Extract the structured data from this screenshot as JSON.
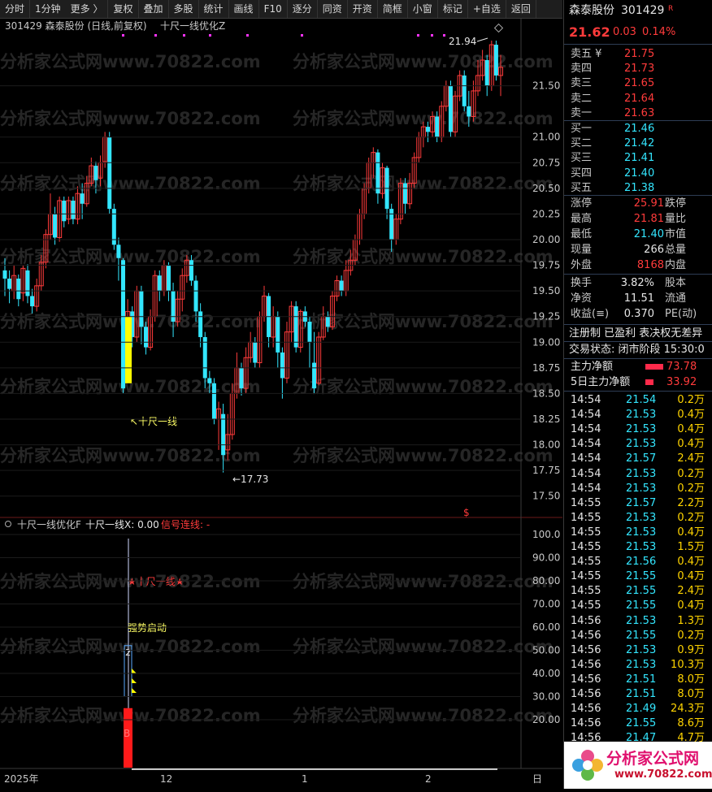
{
  "toolbar": [
    "分时",
    "1分钟",
    "更多 〉",
    "复权",
    "叠加",
    "多股",
    "统计",
    "画线",
    "F10",
    "逐分",
    "同资",
    "开资",
    "简框",
    "小窗",
    "标记",
    "+自选",
    "返回"
  ],
  "main_header": {
    "code_name": "301429 森泰股份 (日线,前复权)",
    "indicator": "十尺一线优化Z"
  },
  "sub_header": {
    "name": "十尺一线优化F",
    "value_label": "十尺一线X: 0.00",
    "signal_label": "信号连线: -"
  },
  "watermark_text": "分析家公式网www.70822.com",
  "chart_data": [
    {
      "type": "candlestick",
      "title": "301429 森泰股份 (日线,前复权)",
      "yticks": [
        "21.50",
        "21.00",
        "20.75",
        "20.50",
        "20.25",
        "20.00",
        "19.75",
        "19.50",
        "19.25",
        "19.00",
        "18.75",
        "18.50",
        "18.25",
        "18.00",
        "17.75",
        "17.50"
      ],
      "ylim": [
        17.5,
        22.05
      ],
      "candles": [
        [
          19.7,
          19.62,
          19.82,
          19.45
        ],
        [
          19.62,
          19.52,
          19.7,
          19.38
        ],
        [
          19.5,
          19.65,
          19.75,
          19.42
        ],
        [
          19.62,
          19.42,
          19.66,
          19.35
        ],
        [
          19.48,
          19.72,
          19.75,
          19.4
        ],
        [
          19.7,
          19.45,
          19.76,
          19.38
        ],
        [
          19.45,
          19.35,
          19.52,
          19.28
        ],
        [
          19.35,
          19.55,
          19.62,
          19.3
        ],
        [
          19.55,
          19.78,
          19.85,
          19.5
        ],
        [
          19.78,
          20.05,
          20.1,
          19.72
        ],
        [
          20.05,
          20.25,
          20.45,
          20.0
        ],
        [
          20.25,
          20.02,
          20.32,
          19.95
        ],
        [
          20.02,
          20.38,
          20.42,
          19.98
        ],
        [
          20.38,
          20.18,
          20.42,
          20.12
        ],
        [
          20.2,
          20.38,
          20.42,
          20.15
        ],
        [
          20.38,
          20.2,
          20.42,
          20.15
        ],
        [
          20.2,
          20.45,
          20.52,
          20.15
        ],
        [
          20.45,
          20.35,
          20.55,
          20.2
        ],
        [
          20.35,
          20.55,
          20.62,
          20.32
        ],
        [
          20.55,
          20.72,
          20.8,
          20.52
        ],
        [
          20.72,
          20.58,
          20.76,
          20.45
        ],
        [
          20.6,
          20.75,
          20.82,
          20.52
        ],
        [
          20.76,
          21.0,
          21.05,
          20.7
        ],
        [
          21.0,
          20.3,
          21.05,
          20.25
        ],
        [
          20.3,
          19.95,
          20.35,
          19.9
        ],
        [
          19.95,
          19.82,
          20.02,
          19.6
        ],
        [
          19.8,
          18.55,
          19.82,
          18.5
        ],
        [
          18.9,
          19.3,
          19.42,
          18.88
        ],
        [
          19.3,
          19.05,
          19.35,
          18.95
        ],
        [
          19.05,
          19.5,
          19.55,
          19.0
        ],
        [
          19.5,
          19.15,
          19.55,
          18.98
        ],
        [
          19.15,
          18.95,
          19.2,
          18.88
        ],
        [
          18.95,
          19.25,
          19.32,
          18.92
        ],
        [
          19.25,
          19.65,
          19.7,
          19.2
        ],
        [
          19.65,
          19.5,
          19.7,
          19.4
        ],
        [
          19.5,
          19.75,
          19.8,
          19.45
        ],
        [
          19.75,
          19.5,
          19.78,
          19.4
        ],
        [
          19.5,
          19.2,
          19.58,
          19.05
        ],
        [
          19.2,
          19.42,
          19.5,
          19.15
        ],
        [
          19.42,
          19.65,
          19.72,
          19.3
        ],
        [
          19.65,
          19.8,
          19.85,
          19.58
        ],
        [
          19.8,
          19.6,
          19.85,
          19.55
        ],
        [
          19.6,
          19.3,
          19.65,
          19.2
        ],
        [
          19.3,
          19.05,
          19.38,
          18.95
        ],
        [
          19.05,
          18.65,
          19.1,
          18.55
        ],
        [
          18.65,
          18.6,
          18.72,
          18.5
        ],
        [
          18.6,
          18.25,
          18.65,
          18.2
        ],
        [
          18.25,
          18.35,
          18.42,
          17.95
        ],
        [
          18.3,
          17.9,
          18.4,
          17.73
        ],
        [
          17.95,
          18.1,
          18.3,
          17.85
        ],
        [
          18.1,
          18.5,
          18.6,
          18.05
        ],
        [
          18.5,
          18.75,
          18.9,
          18.45
        ],
        [
          18.75,
          18.55,
          18.8,
          18.48
        ],
        [
          18.55,
          18.85,
          18.95,
          18.5
        ],
        [
          18.85,
          19.0,
          19.1,
          18.8
        ],
        [
          19.0,
          18.8,
          19.05,
          18.75
        ],
        [
          18.8,
          19.25,
          19.3,
          18.75
        ],
        [
          19.25,
          19.45,
          19.55,
          19.2
        ],
        [
          19.45,
          19.05,
          19.48,
          18.95
        ],
        [
          19.05,
          19.25,
          19.35,
          18.95
        ],
        [
          19.25,
          18.9,
          19.3,
          18.75
        ],
        [
          18.9,
          18.65,
          18.95,
          18.45
        ],
        [
          18.65,
          19.1,
          19.2,
          18.6
        ],
        [
          19.1,
          19.35,
          19.4,
          19.0
        ],
        [
          19.35,
          18.95,
          19.4,
          18.9
        ],
        [
          18.95,
          19.3,
          19.32,
          18.9
        ],
        [
          19.3,
          19.2,
          19.35,
          19.15
        ],
        [
          19.2,
          19.0,
          19.25,
          18.75
        ],
        [
          18.8,
          18.55,
          19.1,
          18.5
        ],
        [
          18.6,
          19.05,
          19.1,
          18.58
        ],
        [
          19.05,
          19.25,
          19.35,
          19.02
        ],
        [
          19.25,
          19.15,
          19.3,
          19.1
        ],
        [
          19.15,
          19.45,
          19.5,
          19.12
        ],
        [
          19.45,
          19.6,
          19.65,
          19.4
        ],
        [
          19.6,
          19.5,
          19.65,
          19.45
        ],
        [
          19.5,
          19.7,
          19.8,
          19.45
        ],
        [
          19.7,
          19.8,
          19.9,
          19.65
        ],
        [
          19.8,
          20.0,
          20.05,
          19.75
        ],
        [
          20.0,
          20.25,
          20.3,
          19.95
        ],
        [
          20.25,
          20.5,
          20.55,
          20.2
        ],
        [
          20.5,
          20.75,
          20.8,
          20.45
        ],
        [
          20.75,
          20.85,
          20.9,
          20.6
        ],
        [
          20.85,
          20.45,
          20.88,
          20.35
        ],
        [
          20.45,
          20.7,
          20.75,
          20.4
        ],
        [
          20.7,
          20.3,
          20.72,
          20.2
        ],
        [
          20.3,
          20.0,
          20.35,
          19.88
        ],
        [
          20.0,
          20.2,
          20.25,
          19.95
        ],
        [
          20.2,
          20.55,
          20.6,
          20.15
        ],
        [
          20.55,
          20.35,
          20.6,
          20.25
        ],
        [
          20.35,
          20.55,
          20.65,
          20.3
        ],
        [
          20.55,
          20.8,
          20.85,
          20.5
        ],
        [
          20.8,
          21.0,
          21.05,
          20.75
        ],
        [
          21.0,
          21.1,
          21.15,
          20.9
        ],
        [
          21.1,
          21.05,
          21.15,
          20.95
        ],
        [
          21.05,
          21.2,
          21.25,
          21.0
        ],
        [
          21.2,
          21.0,
          21.25,
          20.95
        ],
        [
          21.0,
          21.3,
          21.35,
          20.95
        ],
        [
          21.3,
          21.5,
          21.55,
          21.25
        ],
        [
          21.5,
          21.05,
          21.55,
          21.0
        ],
        [
          21.05,
          21.4,
          21.45,
          21.0
        ],
        [
          21.4,
          21.6,
          21.65,
          21.35
        ],
        [
          21.6,
          21.3,
          21.65,
          21.25
        ],
        [
          21.3,
          21.2,
          21.45,
          21.1
        ],
        [
          21.2,
          21.45,
          21.55,
          21.15
        ],
        [
          21.45,
          21.6,
          21.75,
          21.4
        ],
        [
          21.6,
          21.75,
          21.85,
          21.55
        ],
        [
          21.75,
          21.5,
          21.8,
          21.4
        ],
        [
          21.5,
          21.9,
          21.94,
          21.45
        ],
        [
          21.9,
          21.6,
          21.94,
          21.55
        ],
        [
          21.6,
          21.68,
          21.8,
          21.4
        ]
      ],
      "annotations": [
        {
          "text": "21.94",
          "at": 21.94
        },
        {
          "text": "↖十尺一线"
        },
        {
          "text": "←17.73",
          "at": 17.73
        }
      ]
    },
    {
      "type": "bar",
      "title": "十尺一线优化F",
      "yticks": [
        "100.0",
        "90.00",
        "80.00",
        "70.00",
        "60.00",
        "50.00",
        "40.00",
        "30.00",
        "20.00"
      ],
      "ylim": [
        0,
        105
      ],
      "annotations": [
        {
          "text": "★十尺一线★"
        },
        {
          "text": "强势启动"
        },
        {
          "text": "2"
        },
        {
          "text": "B"
        }
      ],
      "values": [
        {
          "name": "red-bar",
          "value": 25
        },
        {
          "name": "box",
          "from": 30,
          "to": 52
        }
      ]
    }
  ],
  "x_axis": [
    "2025年",
    "12",
    "1",
    "2"
  ],
  "bottom_right_label": "日",
  "right_panel": {
    "stock": {
      "name": "森泰股份",
      "code": "301429",
      "badge": "R"
    },
    "quote": {
      "price": "21.62",
      "change": "0.03",
      "pct": "0.14%"
    },
    "asks": [
      [
        "卖五 ¥",
        "21.75"
      ],
      [
        "卖四",
        "21.73"
      ],
      [
        "卖三",
        "21.65"
      ],
      [
        "卖二",
        "21.64"
      ],
      [
        "卖一",
        "21.63"
      ]
    ],
    "bids": [
      [
        "买一",
        "21.46"
      ],
      [
        "买二",
        "21.42"
      ],
      [
        "买三",
        "21.41"
      ],
      [
        "买四",
        "21.40"
      ],
      [
        "买五",
        "21.38"
      ]
    ],
    "stats1": [
      [
        "涨停",
        "25.91",
        "跌停"
      ],
      [
        "最高",
        "21.81",
        "量比"
      ],
      [
        "最低",
        "21.40",
        "市值"
      ],
      [
        "现量",
        "266",
        "总量"
      ],
      [
        "外盘",
        "8168",
        "内盘"
      ]
    ],
    "stats2": [
      [
        "换手",
        "3.82%",
        "股本"
      ],
      [
        "净资",
        "11.51",
        "流通"
      ],
      [
        "收益(≡)",
        "0.370",
        "PE(动)"
      ]
    ],
    "tags": "注册制 已盈利 表决权无差异",
    "state": "交易状态: 闭市阶段 15:30:0",
    "flows": [
      [
        "主力净额",
        "73.78"
      ],
      [
        "5日主力净额",
        "33.92"
      ]
    ],
    "ticks": [
      [
        "14:54",
        "21.54",
        "0.2万"
      ],
      [
        "14:54",
        "21.53",
        "0.4万"
      ],
      [
        "14:54",
        "21.53",
        "0.4万"
      ],
      [
        "14:54",
        "21.53",
        "0.4万"
      ],
      [
        "14:54",
        "21.57",
        "2.4万"
      ],
      [
        "14:54",
        "21.53",
        "0.2万"
      ],
      [
        "14:54",
        "21.53",
        "0.2万"
      ],
      [
        "14:55",
        "21.57",
        "2.2万"
      ],
      [
        "14:55",
        "21.53",
        "0.2万"
      ],
      [
        "14:55",
        "21.53",
        "0.4万"
      ],
      [
        "14:55",
        "21.53",
        "1.5万"
      ],
      [
        "14:55",
        "21.56",
        "0.4万"
      ],
      [
        "14:55",
        "21.55",
        "0.4万"
      ],
      [
        "14:55",
        "21.55",
        "2.4万"
      ],
      [
        "14:55",
        "21.55",
        "0.4万"
      ],
      [
        "14:56",
        "21.53",
        "1.3万"
      ],
      [
        "14:56",
        "21.55",
        "0.2万"
      ],
      [
        "14:56",
        "21.53",
        "0.9万"
      ],
      [
        "14:56",
        "21.53",
        "10.3万"
      ],
      [
        "14:56",
        "21.51",
        "8.0万"
      ],
      [
        "14:56",
        "21.51",
        "8.0万"
      ],
      [
        "14:56",
        "21.49",
        "24.3万"
      ],
      [
        "14:56",
        "21.55",
        "8.6万"
      ],
      [
        "14:56",
        "21.47",
        "4.7万"
      ]
    ]
  },
  "logo": {
    "text": "分析家公式网",
    "url": "www.70822.com"
  }
}
